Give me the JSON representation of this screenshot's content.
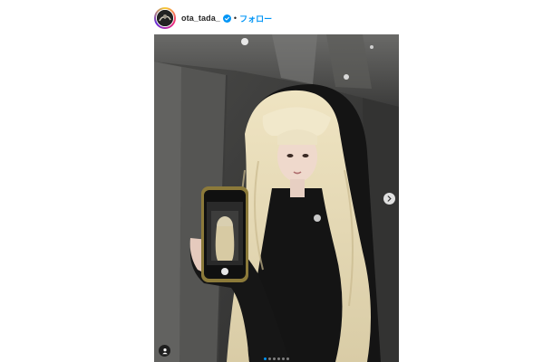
{
  "post": {
    "username": "ota_tada_",
    "separator": "•",
    "follow_label": "フォロー",
    "verified_icon": "verified-badge-icon",
    "carousel": {
      "slide_count": 6,
      "active_index": 0
    }
  },
  "colors": {
    "accent": "#0095f6",
    "text": "#262626"
  }
}
